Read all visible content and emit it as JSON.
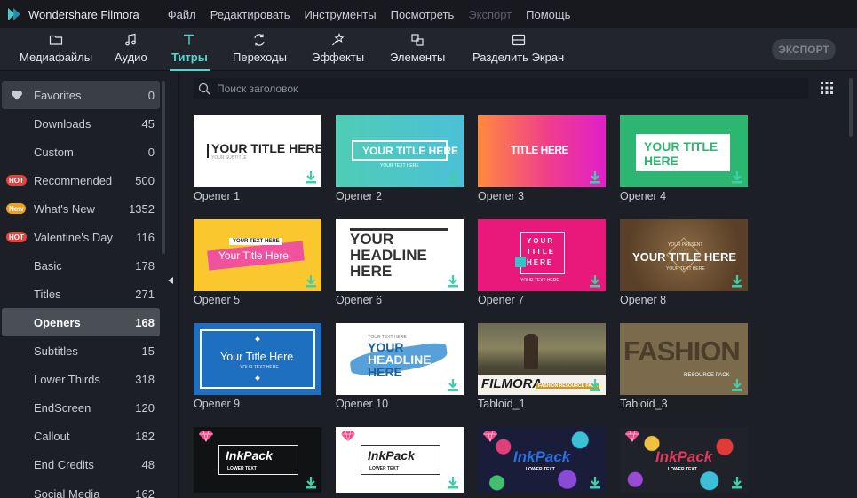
{
  "app": {
    "title": "Wondershare Filmora"
  },
  "menu": [
    "Файл",
    "Редактировать",
    "Инструменты",
    "Посмотреть",
    "Экспорт",
    "Помощь"
  ],
  "toolbar": {
    "tabs": [
      {
        "label": "Медиафайлы",
        "icon": "folder-icon"
      },
      {
        "label": "Аудио",
        "icon": "music-note-icon"
      },
      {
        "label": "Титры",
        "icon": "text-t-icon"
      },
      {
        "label": "Переходы",
        "icon": "transition-icon"
      },
      {
        "label": "Эффекты",
        "icon": "effects-icon"
      },
      {
        "label": "Элементы",
        "icon": "elements-icon"
      },
      {
        "label": "Разделить Экран",
        "icon": "split-screen-icon"
      }
    ],
    "active_tab": "Титры",
    "export_label": "ЭКСПОРТ"
  },
  "sidebar": {
    "items": [
      {
        "label": "Favorites",
        "count": "0",
        "badge": ""
      },
      {
        "label": "Downloads",
        "count": "45",
        "badge": ""
      },
      {
        "label": "Custom",
        "count": "0",
        "badge": ""
      },
      {
        "label": "Recommended",
        "count": "500",
        "badge": "HOT"
      },
      {
        "label": "What's New",
        "count": "1352",
        "badge": "New"
      },
      {
        "label": "Valentine's Day",
        "count": "116",
        "badge": "HOT"
      },
      {
        "label": "Basic",
        "count": "178",
        "badge": ""
      },
      {
        "label": "Titles",
        "count": "271",
        "badge": ""
      },
      {
        "label": "Openers",
        "count": "168",
        "badge": ""
      },
      {
        "label": "Subtitles",
        "count": "15",
        "badge": ""
      },
      {
        "label": "Lower Thirds",
        "count": "318",
        "badge": ""
      },
      {
        "label": "EndScreen",
        "count": "120",
        "badge": ""
      },
      {
        "label": "Callout",
        "count": "182",
        "badge": ""
      },
      {
        "label": "End Credits",
        "count": "48",
        "badge": ""
      },
      {
        "label": "Social Media",
        "count": "162",
        "badge": ""
      }
    ],
    "selected": "Openers"
  },
  "search": {
    "placeholder": "Поиск заголовок"
  },
  "tiles": [
    {
      "label": "Opener 1",
      "text": [
        "YOUR TITLE HERE",
        "YOUR SUBTITLE"
      ]
    },
    {
      "label": "Opener 2",
      "text": [
        "YOUR TITLE HERE",
        "YOUR TEXT HERE"
      ]
    },
    {
      "label": "Opener 3",
      "text": [
        "TITLE HERE"
      ]
    },
    {
      "label": "Opener 4",
      "text": [
        "YOUR TITLE",
        "HERE"
      ]
    },
    {
      "label": "Opener 5",
      "text": [
        "YOUR TEXT HERE",
        "Your Title Here"
      ]
    },
    {
      "label": "Opener 6",
      "text": [
        "YOUR",
        "HEADLINE",
        "HERE"
      ]
    },
    {
      "label": "Opener 7",
      "text": [
        "YOUR",
        "TITLE",
        "HERE",
        "YOUR TEXT HERE"
      ]
    },
    {
      "label": "Opener 8",
      "text": [
        "YOUR PRESENT",
        "YOUR TITLE HERE",
        "YOUR TEXT HERE"
      ]
    },
    {
      "label": "Opener 9",
      "text": [
        "Your Title Here",
        "YOUR TEXT HERE"
      ]
    },
    {
      "label": "Opener 10",
      "text": [
        "YOUR TEXT HERE",
        "YOUR",
        "HEADLINE",
        "HERE"
      ]
    },
    {
      "label": "Tabloid_1",
      "text": [
        "FILMORA",
        "FASHION RESOURCE PACK"
      ]
    },
    {
      "label": "Tabloid_3",
      "text": [
        "FASHION",
        "RESOURCE PACK"
      ]
    },
    {
      "label": "",
      "text": [
        "InkPack",
        "LOWER TEXT"
      ]
    },
    {
      "label": "",
      "text": [
        "InkPack",
        "LOWER TEXT"
      ]
    },
    {
      "label": "",
      "text": [
        "InkPack",
        "LOWER TEXT"
      ]
    },
    {
      "label": "",
      "text": [
        "InkPack",
        "LOWER TEXT"
      ]
    }
  ],
  "colors": {
    "accent": "#56d5d0",
    "download": "#3ecfa8",
    "hot": "#e8403f",
    "new": "#f0a020"
  }
}
